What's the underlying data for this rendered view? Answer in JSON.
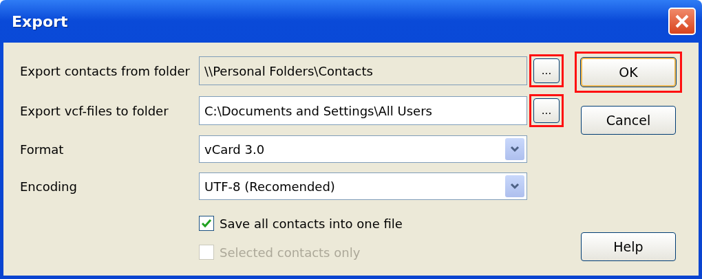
{
  "window": {
    "title": "Export"
  },
  "rows": [
    {
      "kind": "path",
      "label": "Export contacts from folder",
      "value": "\\\\Personal Folders\\Contacts",
      "readonly": true,
      "browse": "...",
      "highlighted": true
    },
    {
      "kind": "path",
      "label": "Export vcf-files to folder",
      "value": "C:\\Documents and Settings\\All Users",
      "readonly": false,
      "browse": "...",
      "highlighted": true
    },
    {
      "kind": "combo",
      "label": "Format",
      "value": "vCard 3.0"
    },
    {
      "kind": "combo",
      "label": "Encoding",
      "value": "UTF-8 (Recomended)"
    }
  ],
  "options": [
    {
      "label": "Save all contacts into one file",
      "checked": true,
      "disabled": false
    },
    {
      "label": "Selected contacts only",
      "checked": false,
      "disabled": true
    }
  ],
  "buttons": [
    {
      "label": "OK",
      "default": true,
      "highlighted": true
    },
    {
      "label": "Cancel",
      "default": false,
      "highlighted": false
    },
    {
      "label": "Help",
      "default": false,
      "highlighted": false
    }
  ]
}
